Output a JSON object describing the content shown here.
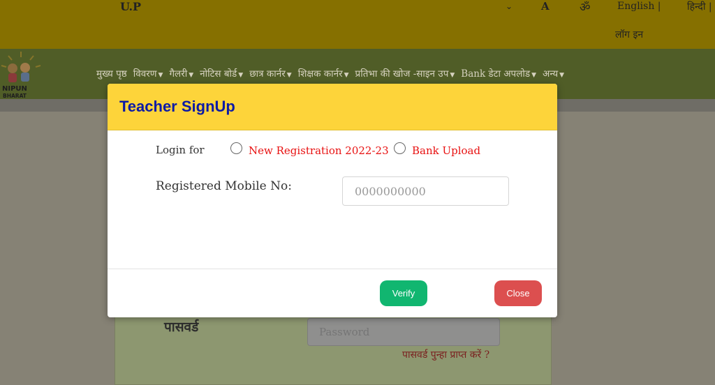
{
  "header": {
    "state": "U.P",
    "font_button": "A",
    "om_symbol": "ॐ",
    "lang_english": "English |",
    "lang_hindi": "हिन्दी |",
    "login_link": "लॉग इन",
    "caret": "⌄"
  },
  "nav": {
    "items": [
      {
        "label": "मुख्य पृष्ठ",
        "dropdown": false
      },
      {
        "label": "विवरण",
        "dropdown": true
      },
      {
        "label": "गैलरी",
        "dropdown": true
      },
      {
        "label": "नोटिस बोर्ड",
        "dropdown": true
      },
      {
        "label": "छात्र कार्नर",
        "dropdown": true
      },
      {
        "label": "शिक्षक कार्नर",
        "dropdown": true
      },
      {
        "label": "प्रतिभा की खोज -साइन उप",
        "dropdown": true
      },
      {
        "label": "Bank डेटा अपलोड",
        "dropdown": true
      },
      {
        "label": "अन्य",
        "dropdown": true
      }
    ]
  },
  "logo": {
    "text_line1": "NIPUN",
    "text_line2": "BHARAT"
  },
  "background_form": {
    "password_label": "पासवर्ड",
    "password_placeholder": "Password",
    "forgot_link": "पासवर्ड पुन्हा प्राप्त करें ?"
  },
  "modal": {
    "title": "Teacher SignUp",
    "login_for_label": "Login for",
    "options": [
      "New Registration 2022-23",
      "Bank Upload"
    ],
    "mobile_label": "Registered Mobile No:",
    "mobile_placeholder": "0000000000",
    "verify_label": "Verify",
    "close_label": "Close"
  },
  "colors": {
    "header_yellow": "#fdd43a",
    "title_blue": "#0c1aa6",
    "option_red": "#e81111",
    "verify_green": "#11b670",
    "close_red": "#dc4f4f"
  }
}
